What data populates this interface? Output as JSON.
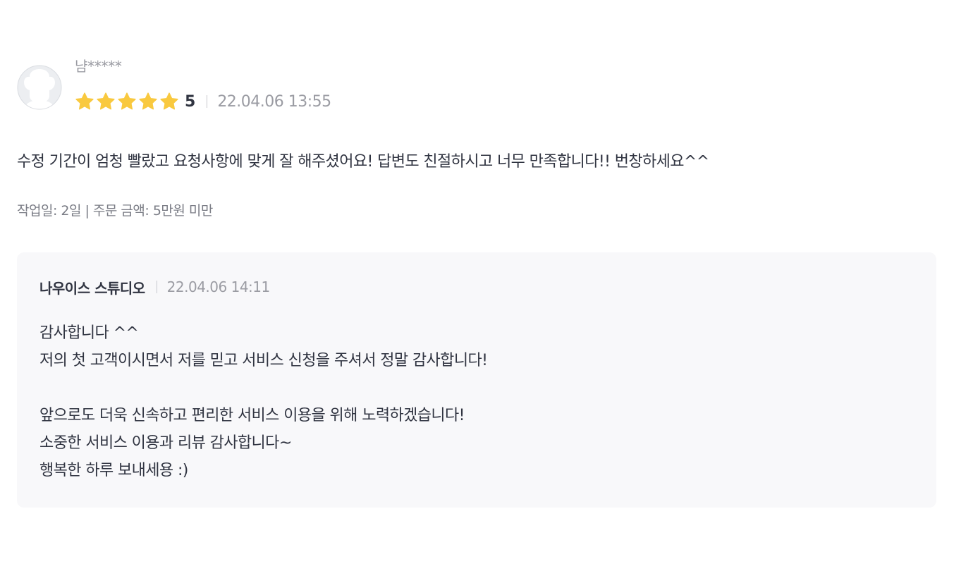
{
  "review": {
    "author": "냠*****",
    "rating_value": 5,
    "rating_label": "5",
    "stars_filled": 5,
    "stars_total": 5,
    "star_color": "#f9c93f",
    "date": "22.04.06 13:55",
    "content": "수정 기간이 엄청 빨랐고 요청사항에 맞게 잘 해주셨어요! 답변도 친절하시고 너무 만족합니다!! 번창하세요^^",
    "work_info": "작업일: 2일 | 주문 금액: 5만원 미만"
  },
  "reply": {
    "author": "나우이스 스튜디오",
    "date": "22.04.06 14:11",
    "lines": [
      "감사합니다 ^^",
      "저의 첫 고객이시면서 저를 믿고 서비스 신청을 주셔서 정말 감사합니다!",
      "",
      "앞으로도 더욱 신속하고 편리한 서비스 이용을 위해 노력하겠습니다!",
      "소중한 서비스 이용과 리뷰 감사합니다~",
      "행복한 하루 보내세용 :)"
    ]
  },
  "icons": {
    "avatar": "default-user-avatar-icon",
    "star": "star-icon"
  }
}
